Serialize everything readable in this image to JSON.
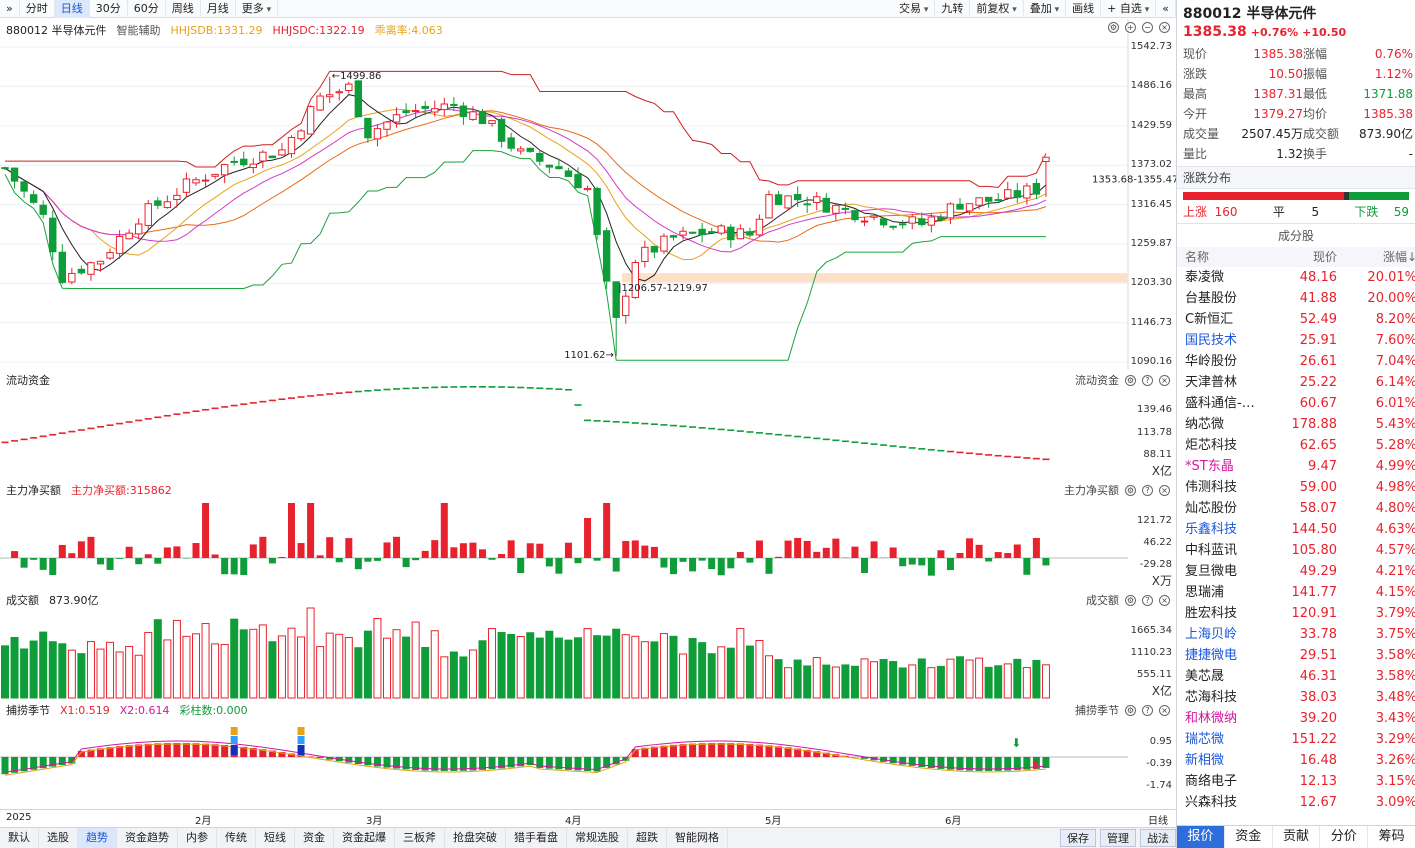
{
  "toolbar": {
    "left": [
      "»",
      "分时",
      "日线",
      "30分",
      "60分",
      "周线",
      "月线",
      "更多"
    ],
    "right": [
      "交易",
      "九转",
      "前复权",
      "叠加",
      "画线",
      "+ 自选",
      "«"
    ]
  },
  "kchart": {
    "code_name": "880012 半导体元件",
    "assist": "智能辅助",
    "hhjsdb": "HHJSDB:1331.29",
    "hhjsdc": "HHJSDC:1322.19",
    "dev": "乖离率:4.063",
    "yticks": [
      "1542.73",
      "1486.16",
      "1429.59",
      "1373.02",
      "1316.45",
      "1259.87",
      "1203.30",
      "1146.73",
      "1090.16"
    ],
    "ann_high": "1499.86",
    "ann_low": "1101.62",
    "ann_zone": "1206.57-1219.97",
    "ann_last": "1353.68-1355.47"
  },
  "flow": {
    "title": "流动资金",
    "yticks": [
      "139.46",
      "113.78",
      "88.11"
    ],
    "unit": "X亿"
  },
  "zl": {
    "title": "主力净买额",
    "value": "主力净买额:315862",
    "yticks": [
      "121.72",
      "46.22",
      "-29.28"
    ],
    "unit": "X万"
  },
  "vol": {
    "title": "成交额",
    "value": "873.90亿",
    "yticks": [
      "1665.34",
      "1110.23",
      "555.11"
    ],
    "unit": "X亿"
  },
  "bu": {
    "title": "捕捞季节",
    "x1": "X1:0.519",
    "x2": "X2:0.614",
    "bar": "彩柱数:0.000",
    "yticks": [
      "0.95",
      "-0.39",
      "-1.74"
    ]
  },
  "xaxis": {
    "labels": [
      "2025",
      "2月",
      "3月",
      "4月",
      "5月",
      "6月"
    ],
    "right": "日线"
  },
  "bottom_tabs": [
    "默认",
    "选股",
    "趋势",
    "资金趋势",
    "内参",
    "传统",
    "短线",
    "资金",
    "资金起爆",
    "三板斧",
    "抢盘突破",
    "猎手看盘",
    "常规选股",
    "超跌",
    "智能网格"
  ],
  "bottom_right": [
    "保存",
    "管理",
    "战法"
  ],
  "panel": {
    "title": "880012 半导体元件",
    "price": "1385.38",
    "chg_pct": "+0.76%",
    "chg": "+10.50",
    "stats": [
      [
        "现价",
        "1385.38",
        "涨幅",
        "0.76%"
      ],
      [
        "涨跌",
        "10.50",
        "振幅",
        "1.12%"
      ],
      [
        "最高",
        "1387.31",
        "最低",
        "1371.88"
      ],
      [
        "今开",
        "1379.27",
        "均价",
        "1385.38"
      ],
      [
        "成交量",
        "2507.45万",
        "成交额",
        "873.90亿"
      ],
      [
        "量比",
        "1.32",
        "换手",
        "-"
      ]
    ],
    "dist_title": "涨跌分布",
    "up_label": "上涨",
    "up": "160",
    "flat_label": "平",
    "flat": "5",
    "down_label": "下跌",
    "down": "59",
    "comp_title": "成分股",
    "col_name": "名称",
    "col_price": "现价",
    "col_pct": "涨幅↓",
    "stocks": [
      {
        "name": "泰凌微",
        "price": "48.16",
        "pct": "20.01%"
      },
      {
        "name": "台基股份",
        "price": "41.88",
        "pct": "20.00%"
      },
      {
        "name": "C新恒汇",
        "price": "52.49",
        "pct": "8.20%"
      },
      {
        "name": "国民技术",
        "price": "25.91",
        "pct": "7.60%",
        "nc": "blue"
      },
      {
        "name": "华岭股份",
        "price": "26.61",
        "pct": "7.04%"
      },
      {
        "name": "天津普林",
        "price": "25.22",
        "pct": "6.14%"
      },
      {
        "name": "盛科通信-…",
        "price": "60.67",
        "pct": "6.01%"
      },
      {
        "name": "纳芯微",
        "price": "178.88",
        "pct": "5.43%"
      },
      {
        "name": "炬芯科技",
        "price": "62.65",
        "pct": "5.28%"
      },
      {
        "name": "*ST东晶",
        "price": "9.47",
        "pct": "4.99%",
        "nc": "magenta"
      },
      {
        "name": "伟测科技",
        "price": "59.00",
        "pct": "4.98%"
      },
      {
        "name": "灿芯股份",
        "price": "58.07",
        "pct": "4.80%"
      },
      {
        "name": "乐鑫科技",
        "price": "144.50",
        "pct": "4.63%",
        "nc": "blue"
      },
      {
        "name": "中科蓝讯",
        "price": "105.80",
        "pct": "4.57%"
      },
      {
        "name": "复旦微电",
        "price": "49.29",
        "pct": "4.21%"
      },
      {
        "name": "思瑞浦",
        "price": "141.77",
        "pct": "4.15%"
      },
      {
        "name": "胜宏科技",
        "price": "120.91",
        "pct": "3.79%"
      },
      {
        "name": "上海贝岭",
        "price": "33.78",
        "pct": "3.75%",
        "nc": "blue"
      },
      {
        "name": "捷捷微电",
        "price": "29.51",
        "pct": "3.58%",
        "nc": "blue"
      },
      {
        "name": "美芯晟",
        "price": "46.31",
        "pct": "3.58%"
      },
      {
        "name": "芯海科技",
        "price": "38.03",
        "pct": "3.48%"
      },
      {
        "name": "和林微纳",
        "price": "39.20",
        "pct": "3.43%",
        "nc": "magenta"
      },
      {
        "name": "瑞芯微",
        "price": "151.22",
        "pct": "3.29%",
        "nc": "blue"
      },
      {
        "name": "新相微",
        "price": "16.48",
        "pct": "3.26%",
        "nc": "blue"
      },
      {
        "name": "商络电子",
        "price": "12.13",
        "pct": "3.15%"
      },
      {
        "name": "兴森科技",
        "price": "12.67",
        "pct": "3.09%"
      }
    ],
    "tabs": [
      "报价",
      "资金",
      "贡献",
      "分价",
      "筹码"
    ]
  },
  "colors": {
    "up": "#e8222d",
    "down": "#0f9d3a",
    "ma5": "#222222",
    "ma10": "#e8a21a",
    "ma20": "#d23ac8",
    "ma60": "#e86b1a",
    "upper": "#d01f1f",
    "lower": "#1aa33a",
    "accent": "#2e6ddc"
  },
  "chart_data": {
    "type": "candlestick",
    "series": [
      {
        "name": "880012 半导体元件",
        "last": 1385.38
      }
    ],
    "high": 1499.86,
    "low": 1101.62,
    "ylim": [
      1090.16,
      1542.73
    ]
  }
}
